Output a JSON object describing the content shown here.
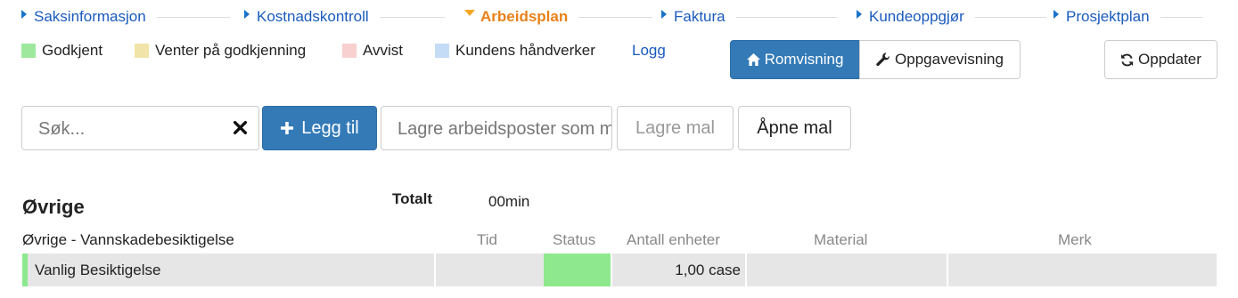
{
  "steps": [
    {
      "label": "Saksinformasjon",
      "active": false
    },
    {
      "label": "Kostnadskontroll",
      "active": false
    },
    {
      "label": "Arbeidsplan",
      "active": true
    },
    {
      "label": "Faktura",
      "active": false
    },
    {
      "label": "Kundeoppgjør",
      "active": false
    },
    {
      "label": "Prosjektplan",
      "active": false
    }
  ],
  "legend": [
    {
      "label": "Godkjent",
      "color": "#9ee89e"
    },
    {
      "label": "Venter på godkjenning",
      "color": "#f0e4a8"
    },
    {
      "label": "Avvist",
      "color": "#f8d0d0"
    },
    {
      "label": "Kundens håndverker",
      "color": "#c4dcf5"
    }
  ],
  "log_link": "Logg",
  "view_toggle": {
    "room_view": "Romvisning",
    "task_view": "Oppgavevisning",
    "selected": "Romvisning"
  },
  "refresh_button": "Oppdater",
  "search": {
    "placeholder": "Søk...",
    "value": ""
  },
  "add_button": "Legg til",
  "save_template_input": {
    "placeholder": "Lagre arbeidsposter som mal",
    "value": ""
  },
  "save_template_button": "Lagre mal",
  "open_template_button": "Åpne mal",
  "section": {
    "title": "Øvrige",
    "total_label": "Totalt",
    "total_value": "00min",
    "subsection_title": "Øvrige - Vannskadebesiktigelse",
    "columns": [
      "Tid",
      "Status",
      "Antall enheter",
      "Material",
      "Merk"
    ],
    "rows": [
      {
        "name": "Vanlig Besiktigelse",
        "tid": "",
        "status": "Godkjent",
        "status_color": "#8ee88e",
        "antall": "1,00 case",
        "material": "",
        "merk": ""
      }
    ]
  },
  "icons": {
    "step_marker": "caret-right-icon",
    "active_step_marker": "caret-down-icon",
    "room_view": "home-icon",
    "task_view": "wrench-icon",
    "refresh": "refresh-icon",
    "clear": "close-icon",
    "add": "plus-icon"
  }
}
